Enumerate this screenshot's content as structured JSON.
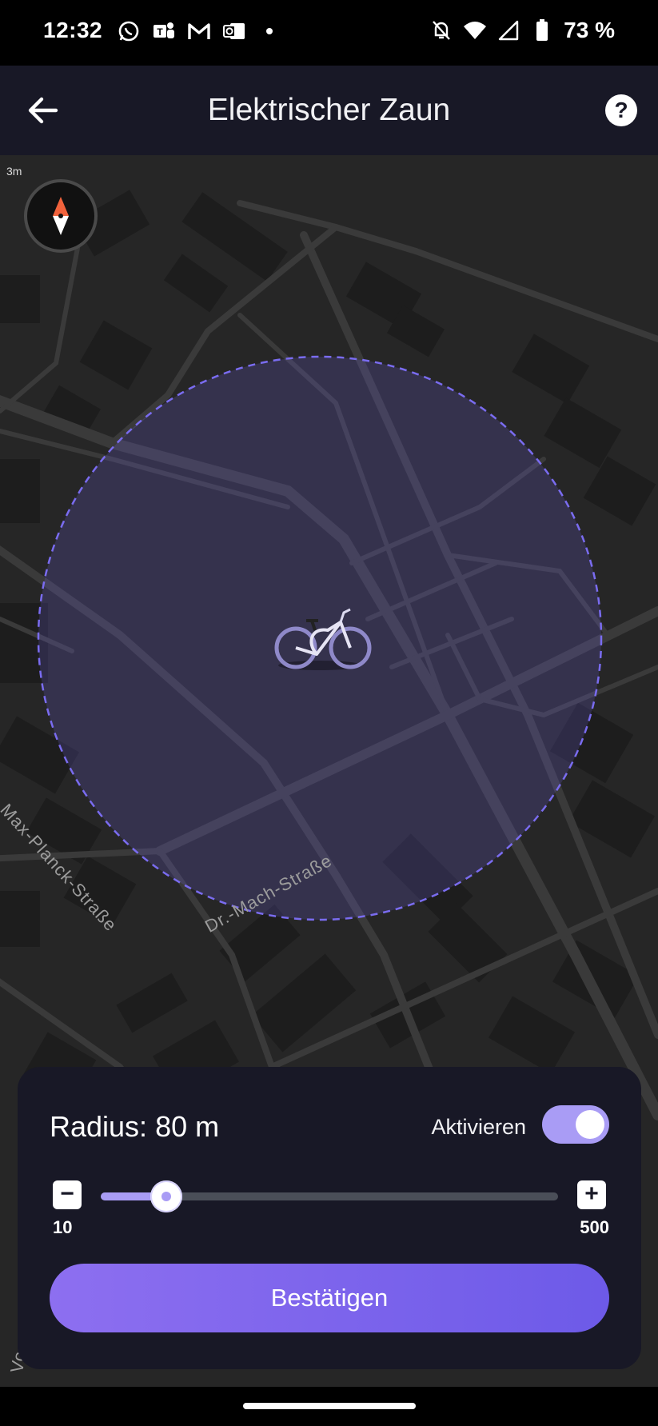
{
  "status_bar": {
    "time": "12:32",
    "battery": "73 %",
    "icons_left": [
      "whatsapp-icon",
      "teams-icon",
      "gmail-icon",
      "outlook-icon",
      "dot-icon"
    ],
    "icons_right": [
      "silent-icon",
      "wifi-icon",
      "signal-icon",
      "battery-icon"
    ]
  },
  "header": {
    "title": "Elektrischer Zaun",
    "back_icon": "arrow-left-icon",
    "help_icon": "help-icon",
    "help_glyph": "?"
  },
  "map": {
    "scale_mark": "3m",
    "streets": [
      "Max-Planck-Straße",
      "Dr.-Mach-Straße",
      "Vo"
    ],
    "fence_color": "#7a6cf0"
  },
  "panel": {
    "radius_label": "Radius: 80 m",
    "activate_label": "Aktivieren",
    "activate_on": true,
    "slider": {
      "min_label": "10",
      "max_label": "500",
      "min": 10,
      "max": 500,
      "value": 80
    },
    "minus_glyph": "−",
    "plus_glyph": "+",
    "confirm_label": "Bestätigen"
  },
  "colors": {
    "accent": "#a99cf5",
    "button": "#7b63ee",
    "panel_bg": "#181826",
    "map_bg": "#262626"
  }
}
